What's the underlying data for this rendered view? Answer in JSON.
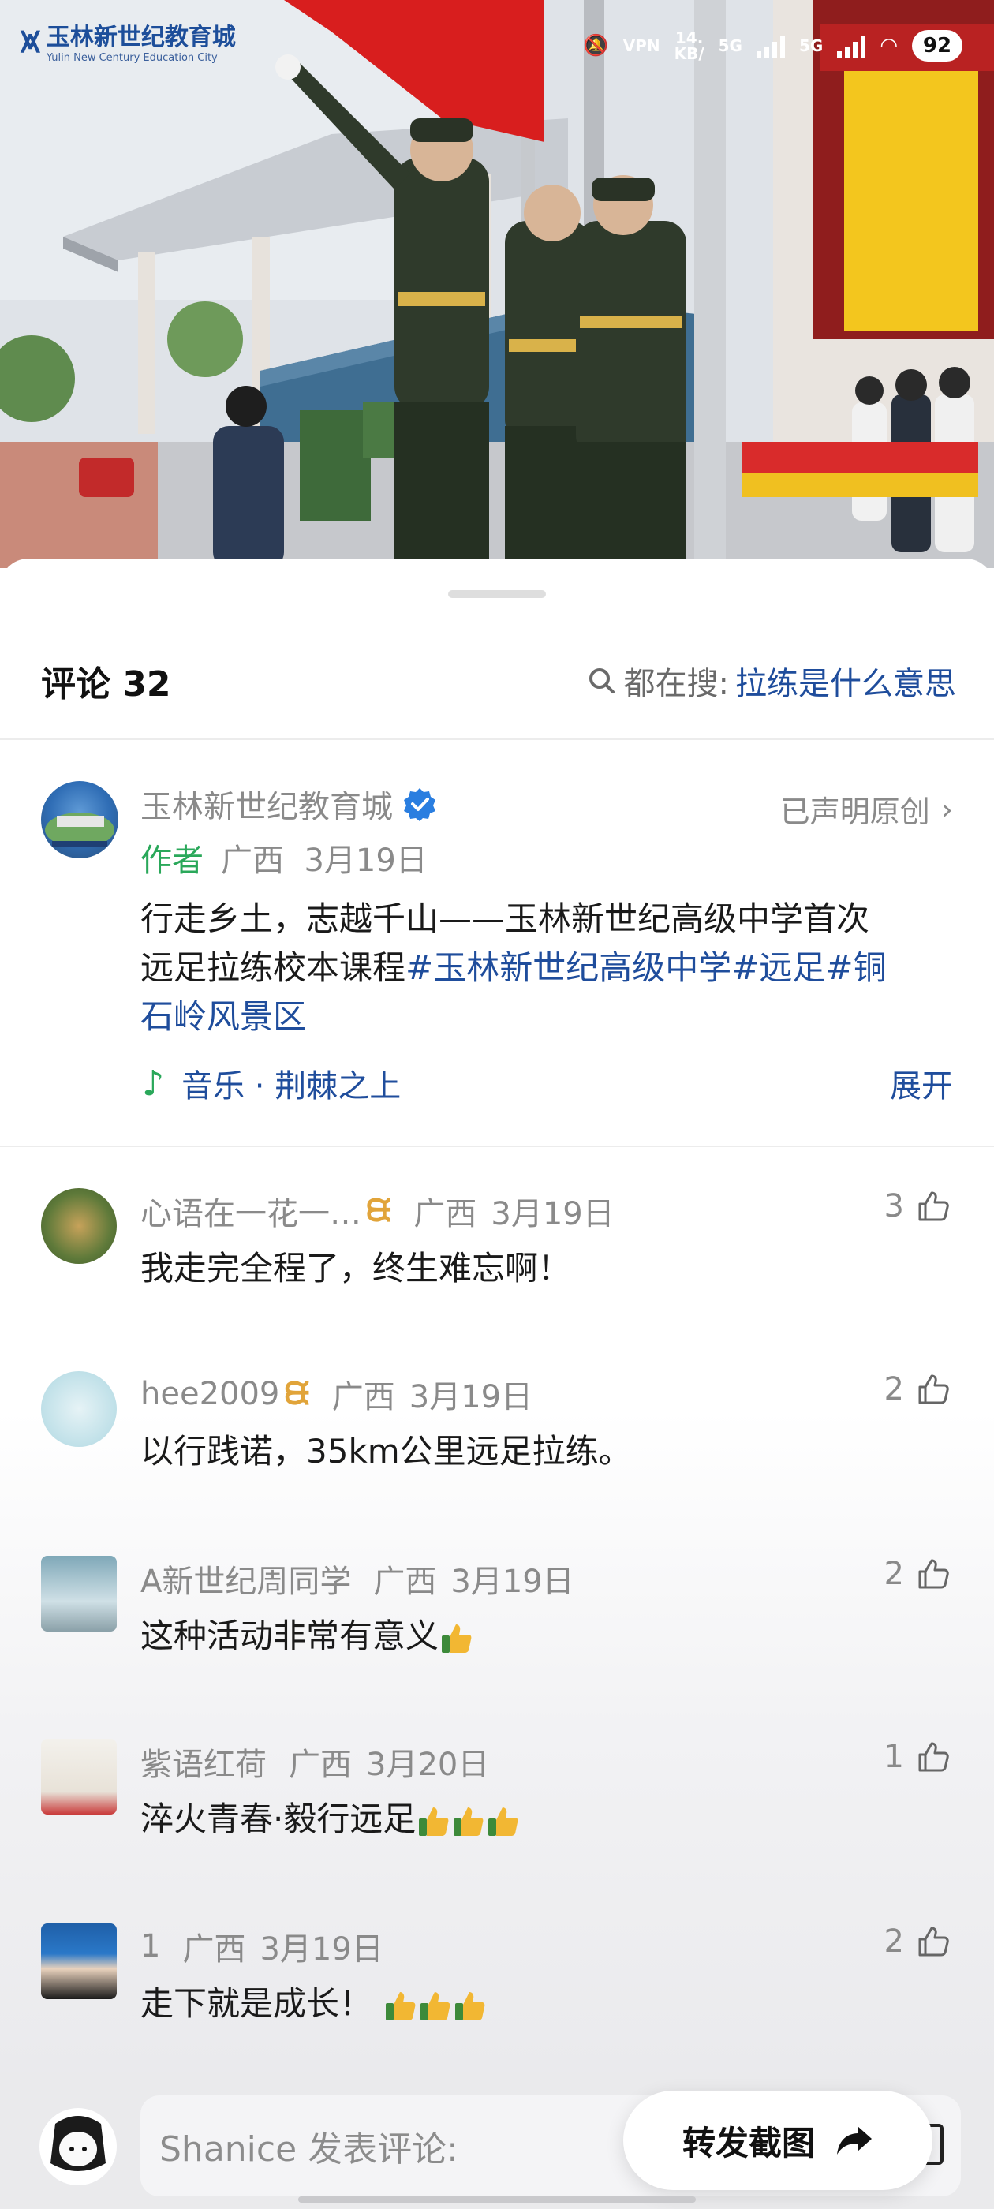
{
  "status_bar": {
    "speed_top": "14.",
    "speed_unit": "KB/",
    "vpn": "VPN",
    "net1": "5G",
    "net2": "5G",
    "battery": "92"
  },
  "logo": {
    "title": "玉林新世纪教育城",
    "subtitle": "Yulin New Century Education City"
  },
  "header": {
    "comments_label": "评论 32",
    "search_prefix": "都在搜:",
    "search_query": "拉练是什么意思"
  },
  "post": {
    "author_name": "玉林新世纪教育城",
    "original_label": "已声明原创",
    "author_tag": "作者",
    "location": "广西",
    "date": "3月19日",
    "line1": "行走乡土，志越千山——玉林新世纪高级中学首次",
    "line2_text": "远足拉练校本课程",
    "tag1": "#玉林新世纪高级中学",
    "tag2": "#远足",
    "tag3a": "#铜",
    "tag3b": "石岭风景区",
    "music_label": "音乐 · 荆棘之上",
    "expand_label": "展开"
  },
  "comments": [
    {
      "name": "心语在一花一…",
      "location": "广西",
      "date": "3月19日",
      "text": "我走完全程了，终生难忘啊！",
      "likes": "3",
      "vip": true
    },
    {
      "name": "hee2009",
      "location": "广西",
      "date": "3月19日",
      "text": "以行践诺，35km公里远足拉练。",
      "likes": "2",
      "vip": true
    },
    {
      "name": "A新世纪周同学",
      "location": "广西",
      "date": "3月19日",
      "text": "这种活动非常有意义",
      "likes": "2",
      "vip": false,
      "thumbs": 1
    },
    {
      "name": "紫语红荷",
      "location": "广西",
      "date": "3月20日",
      "text": "淬火青春·毅行远足",
      "likes": "1",
      "vip": false,
      "thumbs": 3
    },
    {
      "name": "1",
      "location": "广西",
      "date": "3月19日",
      "text": "走下就是成长！",
      "likes": "2",
      "vip": false,
      "thumbs": 3
    }
  ],
  "bottom": {
    "input_placeholder": "Shanice 发表评论:",
    "share_label": "转发截图"
  },
  "colors": {
    "link": "#1f4d9c",
    "author_green": "#2aa85a",
    "vip_gold": "#e1a43a",
    "muted": "#8a8a8a"
  }
}
